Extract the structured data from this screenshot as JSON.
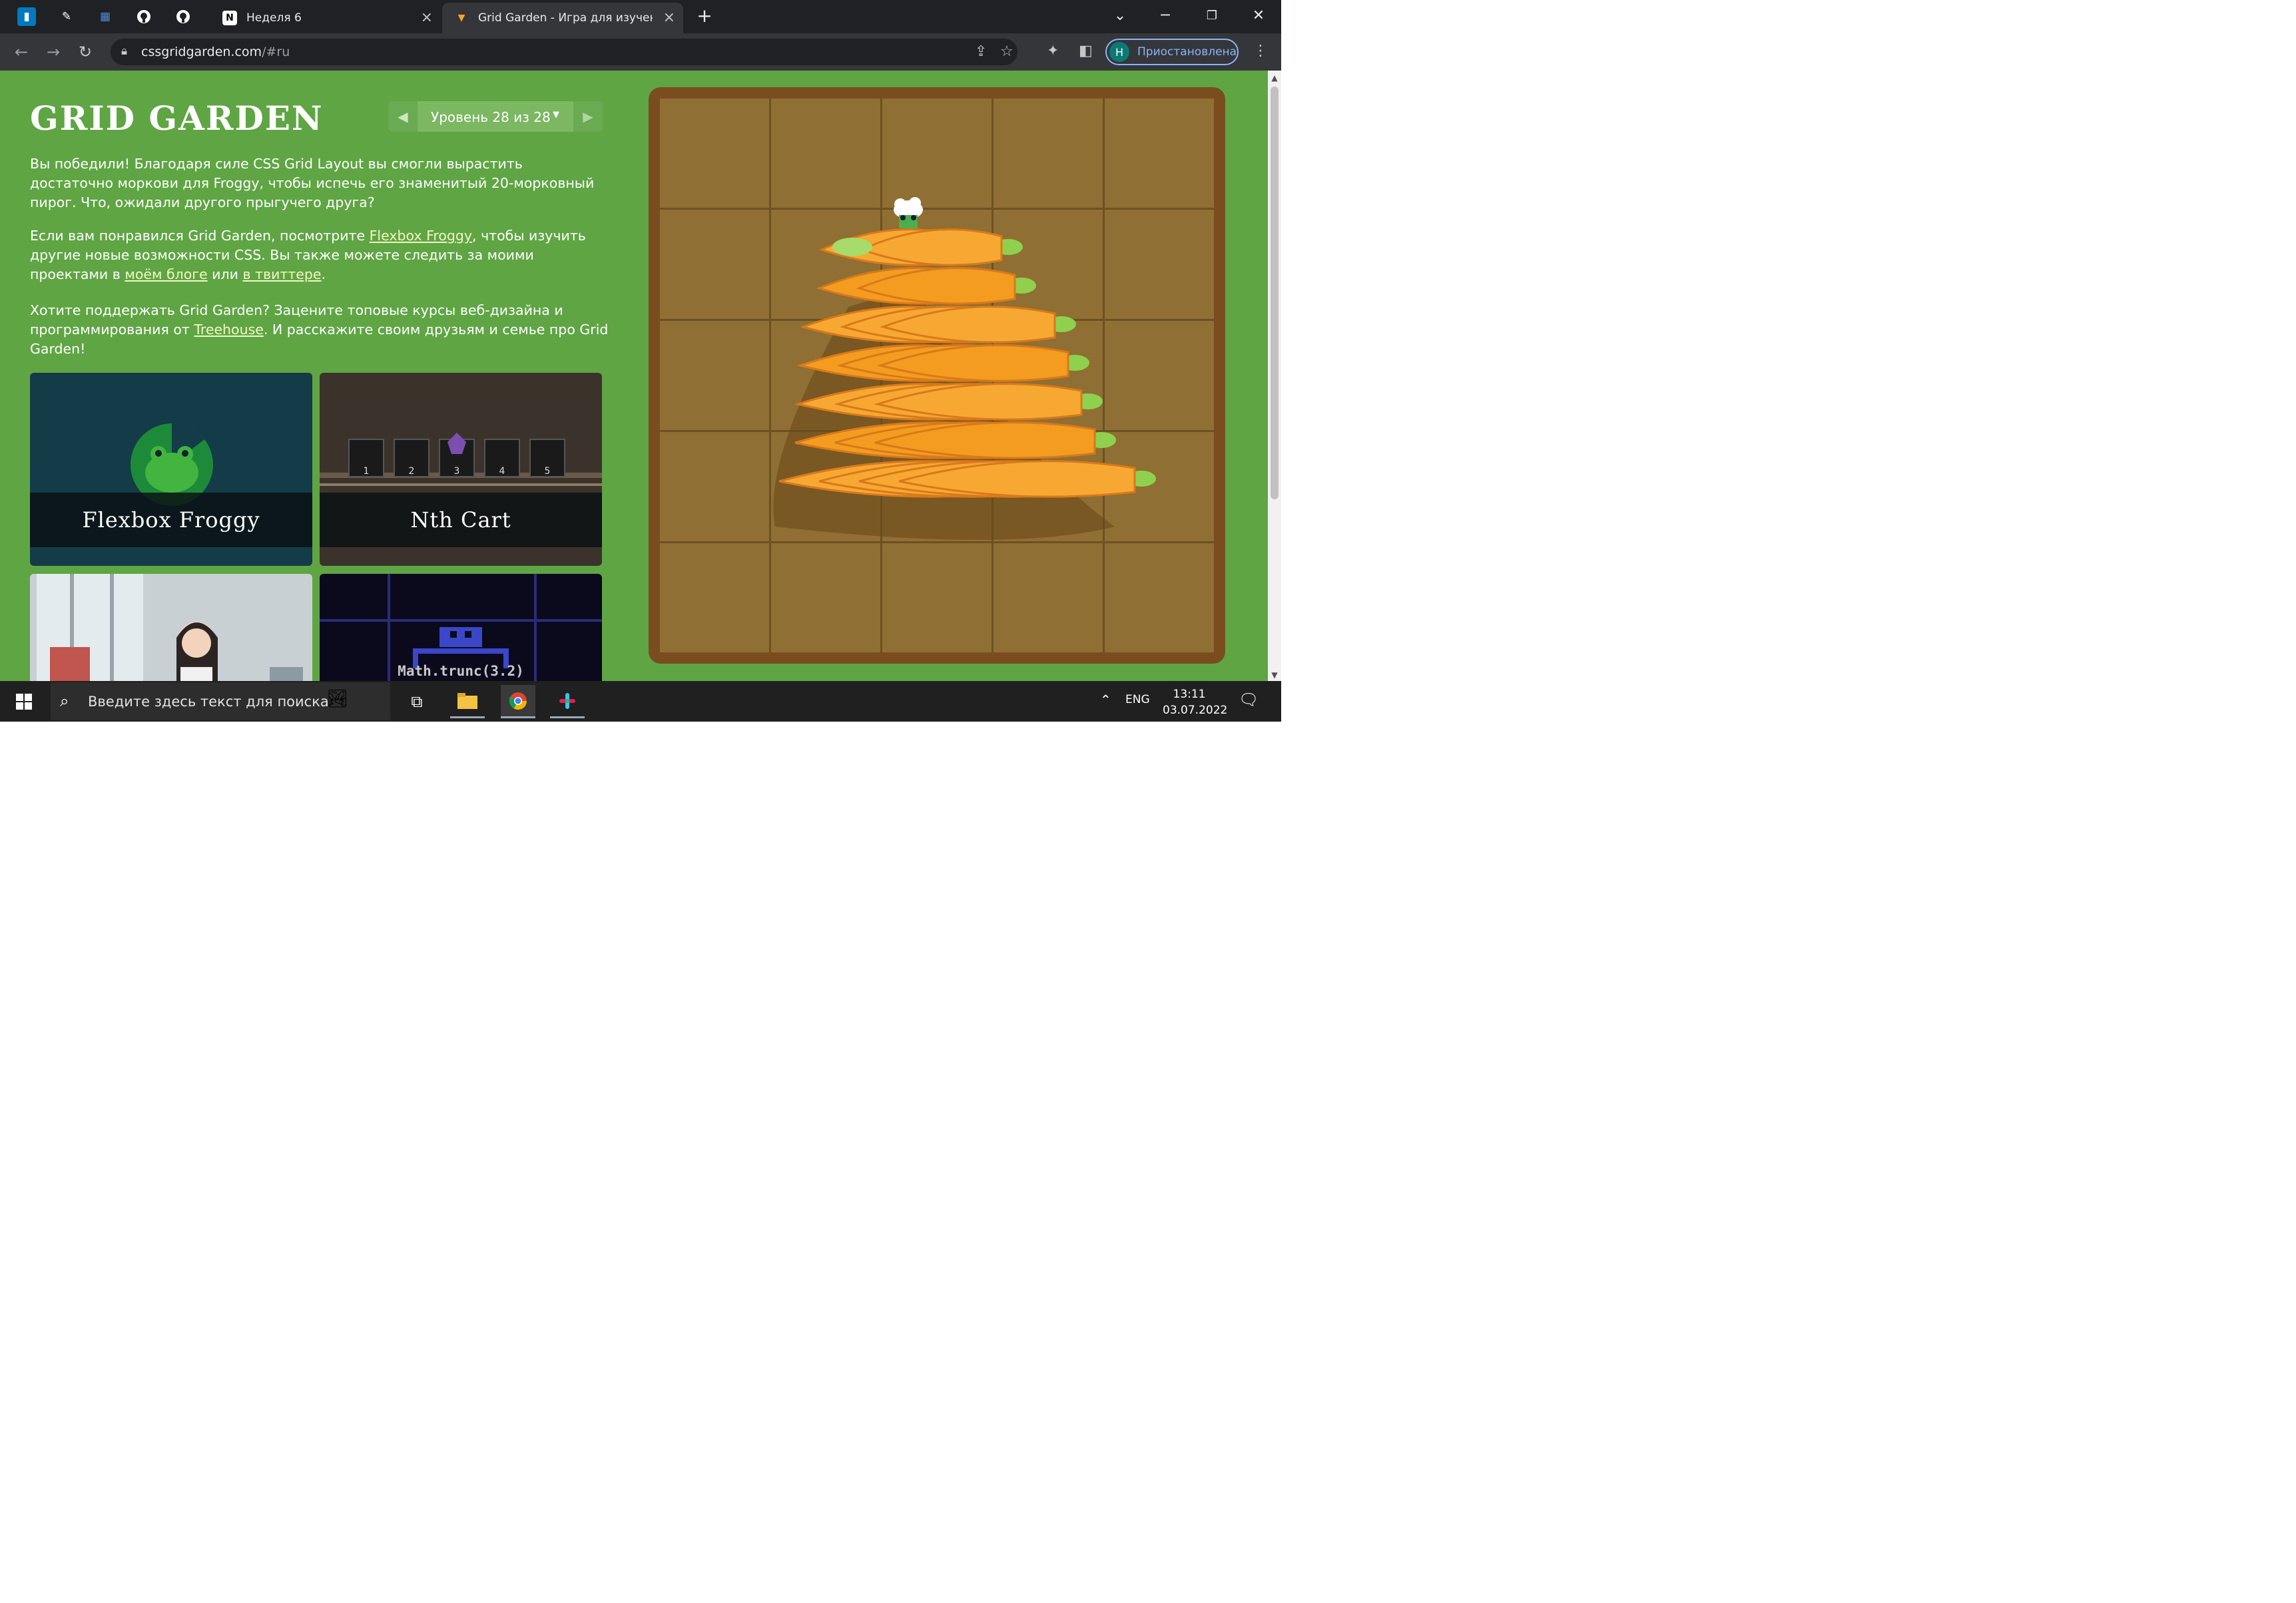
{
  "browser": {
    "pinned_tabs": [
      {
        "icon": "trello-icon",
        "color": "#0079bf"
      },
      {
        "icon": "pen-icon",
        "color": "#ffffff"
      },
      {
        "icon": "windows-app-icon",
        "color": "#4f8be0"
      },
      {
        "icon": "github-icon",
        "color": "#ffffff"
      },
      {
        "icon": "github-icon",
        "color": "#ffffff"
      }
    ],
    "tabs": [
      {
        "title": "Неделя 6",
        "favicon": "notion-icon",
        "active": false
      },
      {
        "title": "Grid Garden - Игра для изучени",
        "favicon": "carrot-icon",
        "active": true
      }
    ],
    "new_tab_symbol": "+",
    "url_host": "cssgridgarden.com",
    "url_rest": "/#ru",
    "profile_initial": "Н",
    "profile_label": "Приостановлена"
  },
  "page": {
    "title": "GRID GARDEN",
    "level_label": "Уровень 28 из 28",
    "paragraphs": {
      "p1": "Вы победили! Благодаря силе CSS Grid Layout вы смогли вырастить достаточно моркови для Froggy, чтобы испечь его знаменитый 20-морковный пирог. Что, ожидали другого прыгучего друга?",
      "p2_a": "Если вам понравился Grid Garden, посмотрите ",
      "p2_link1": "Flexbox Froggy",
      "p2_b": ", чтобы изучить другие новые возможности CSS. Вы также можете следить за моими проектами в ",
      "p2_link2": "моём блоге",
      "p2_c": " или ",
      "p2_link3": "в твиттере",
      "p2_d": ".",
      "p3_a": "Хотите поддержать Grid Garden? Зацените топовые курсы веб-дизайна и программирования от ",
      "p3_link": "Treehouse",
      "p3_b": ". И расскажите своим друзьям и семье про Grid Garden!"
    },
    "cards": [
      {
        "label": "Flexbox Froggy"
      },
      {
        "label": "Nth Cart"
      },
      {
        "label": ""
      },
      {
        "label": "Math.trunc(3.2)"
      }
    ],
    "cart_numbers": [
      "1",
      "2",
      "3",
      "4",
      "5"
    ],
    "garden": {
      "rows": 5,
      "columns": 5,
      "carrot_count": 20
    }
  },
  "taskbar": {
    "search_placeholder": "Введите здесь текст для поиска",
    "language": "ENG",
    "time": "13:11",
    "date": "03.07.2022"
  }
}
